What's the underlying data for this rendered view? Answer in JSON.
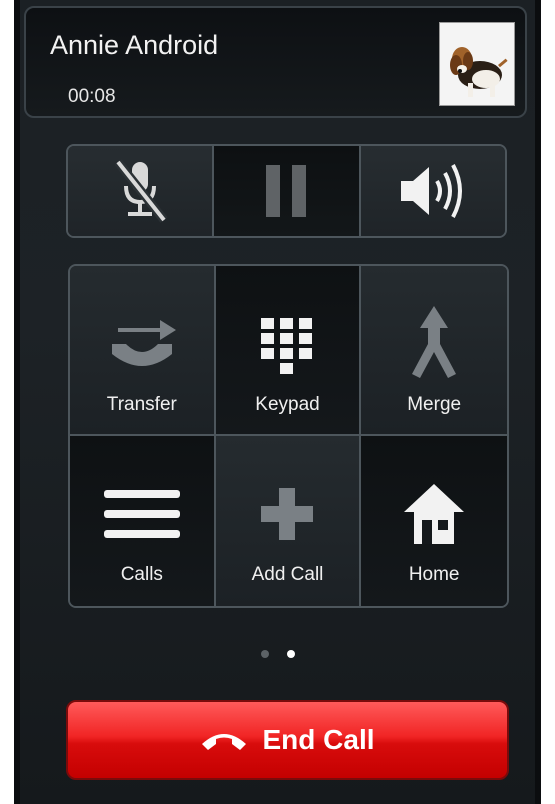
{
  "caller": {
    "name": "Annie Android",
    "duration": "00:08",
    "photo": "beagle-dog-photo"
  },
  "controls": [
    {
      "name": "mute",
      "icon": "muted-microphone-icon"
    },
    {
      "name": "hold",
      "icon": "pause-icon"
    },
    {
      "name": "speaker",
      "icon": "speaker-volume-icon"
    }
  ],
  "actions": [
    {
      "label": "Transfer",
      "icon": "transfer-icon"
    },
    {
      "label": "Keypad",
      "icon": "keypad-icon"
    },
    {
      "label": "Merge",
      "icon": "merge-icon"
    },
    {
      "label": "Calls",
      "icon": "list-icon"
    },
    {
      "label": "Add Call",
      "icon": "plus-icon"
    },
    {
      "label": "Home",
      "icon": "home-icon"
    }
  ],
  "pager": {
    "pages": 2,
    "current": 2
  },
  "end_call": {
    "label": "End Call",
    "icon": "hang-up-icon"
  },
  "colors": {
    "end_call_red": "#e21b1b",
    "panel_border": "#4d565c",
    "background": "#1b2024"
  }
}
